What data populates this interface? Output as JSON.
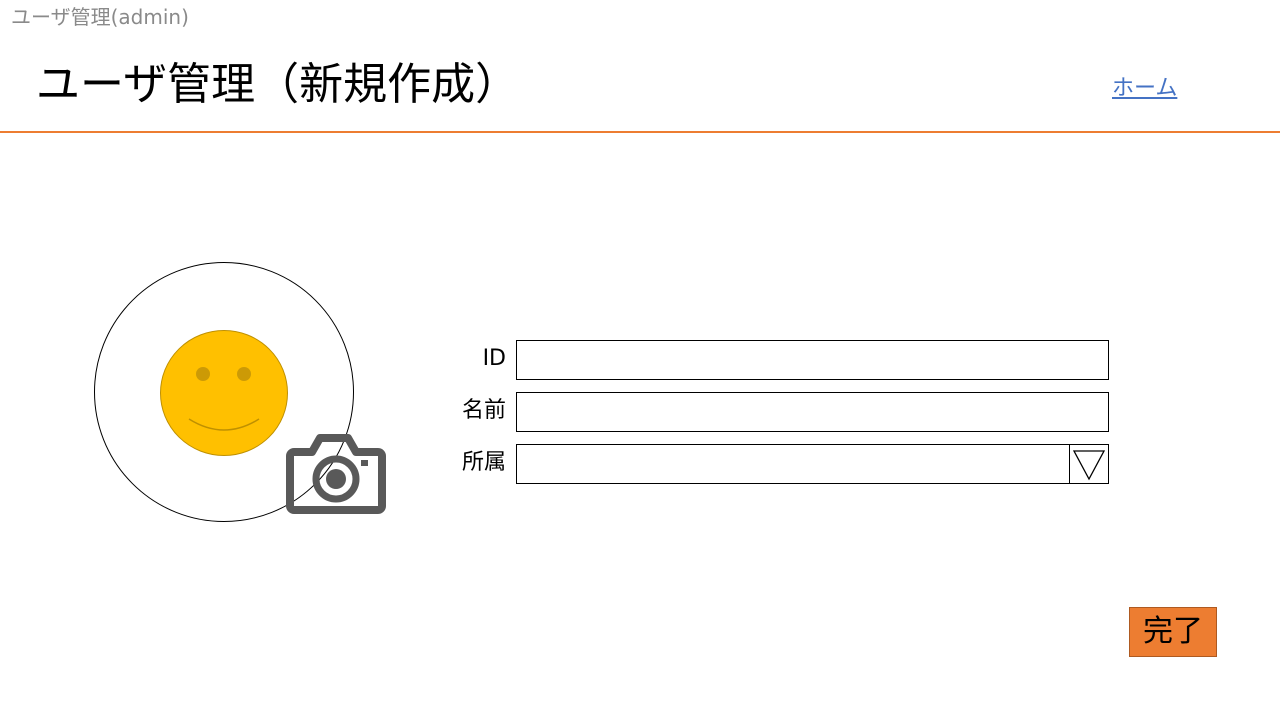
{
  "header": {
    "window_caption": "ユーザ管理(admin)",
    "page_title": "ユーザ管理（新規作成）",
    "home_link": "ホーム"
  },
  "avatar": {
    "image_icon": "smiley-face-icon",
    "upload_icon": "camera-icon"
  },
  "form": {
    "id_label": "ID",
    "id_value": "",
    "name_label": "名前",
    "name_value": "",
    "department_label": "所属",
    "department_value": "",
    "dropdown_icon": "triangle-down-icon"
  },
  "actions": {
    "done_label": "完了"
  },
  "colors": {
    "accent": "#ED7D31",
    "link": "#4472C4",
    "face": "#FFC000",
    "camera": "#595959"
  }
}
